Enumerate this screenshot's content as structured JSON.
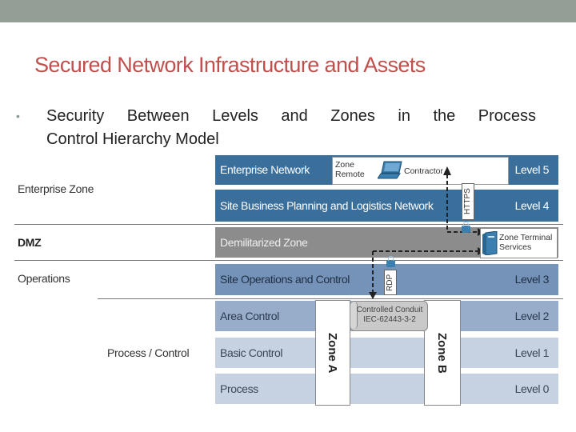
{
  "slide": {
    "title": "Secured Network Infrastructure and Assets",
    "bullet_line1": "Security Between Levels and Zones in the Process",
    "bullet_line2": "Control Hierarchy Model",
    "bullet_marker": "•"
  },
  "diagram": {
    "zones": [
      {
        "label": "Enterprise Zone"
      },
      {
        "label": "DMZ"
      },
      {
        "label": "Operations"
      },
      {
        "label": "Process / Control"
      }
    ],
    "bands": [
      {
        "label": "Enterprise Network",
        "level": "Level 5",
        "color": "#3a6f9c"
      },
      {
        "label": "Site Business Planning and Logistics Network",
        "level": "Level 4",
        "color": "#3a6f9c"
      },
      {
        "label": "Demilitarized Zone",
        "level": "",
        "color": "#8c8c8c"
      },
      {
        "label": "Site Operations and Control",
        "level": "Level 3",
        "color": "#7593b8"
      },
      {
        "label": "Area Control",
        "level": "Level 2",
        "color": "#98adc9"
      },
      {
        "label": "Basic Control",
        "level": "Level 1",
        "color": "#c6d1e1"
      },
      {
        "label": "Process",
        "level": "Level 0",
        "color": "#c6d1e1"
      }
    ],
    "remote_zone": {
      "line1": "Zone",
      "line2": "Remote",
      "contractor": "Contractor"
    },
    "https_label": "HTTPS",
    "rdp_label": "RDP",
    "terminal_services": {
      "line1": "Zone Terminal",
      "line2": "Services"
    },
    "conduit": {
      "line1": "Controlled Conduit",
      "line2": "IEC-62443-3-2"
    },
    "zone_a": "Zone A",
    "zone_b": "Zone B"
  }
}
